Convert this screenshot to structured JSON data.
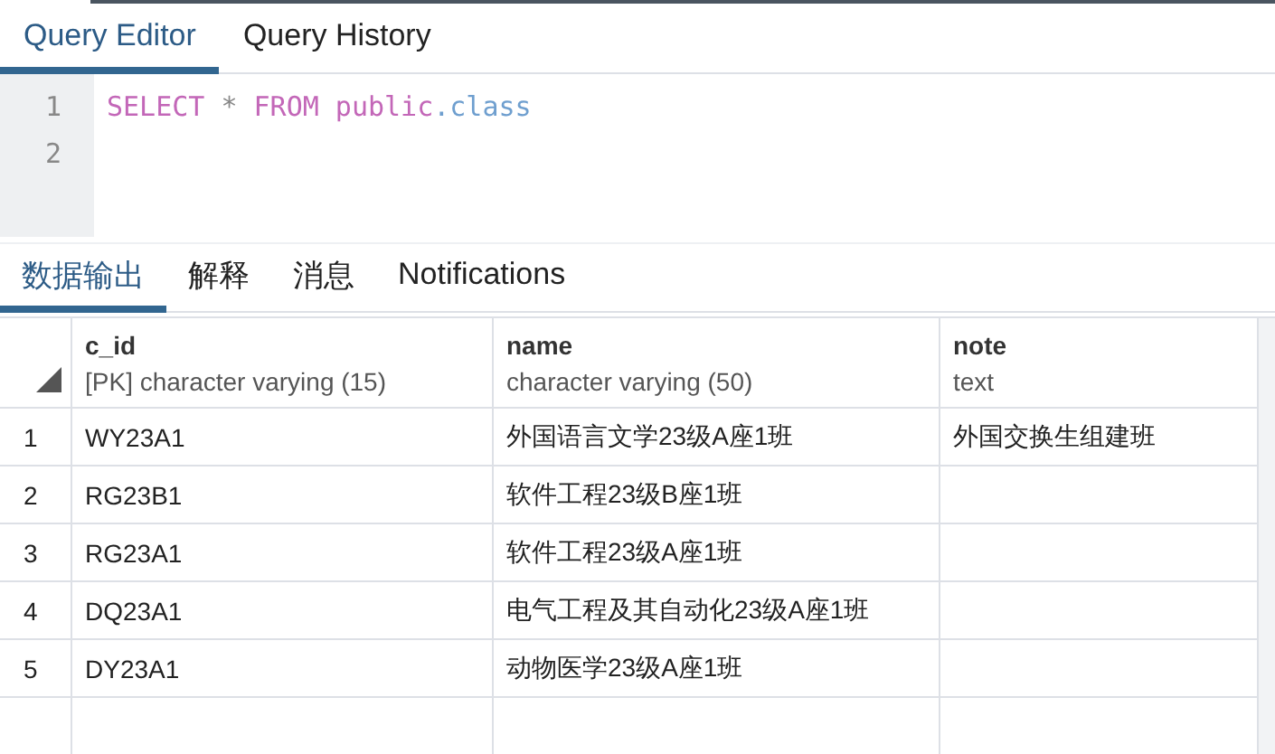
{
  "editor_tabs": [
    {
      "label": "Query Editor",
      "selected": true
    },
    {
      "label": "Query History",
      "selected": false
    }
  ],
  "editor": {
    "lines": [
      {
        "number": "1",
        "tokens": [
          {
            "kind": "keyword",
            "text": "SELECT"
          },
          {
            "kind": "operator",
            "text": " * "
          },
          {
            "kind": "keyword",
            "text": "FROM"
          },
          {
            "kind": "keyword",
            "text": " public"
          },
          {
            "kind": "identifier",
            "text": ".class"
          }
        ]
      },
      {
        "number": "2"
      }
    ]
  },
  "result_tabs": [
    {
      "label": "数据输出",
      "selected": true
    },
    {
      "label": "解释",
      "selected": false
    },
    {
      "label": "消息",
      "selected": false
    },
    {
      "label": "Notifications",
      "selected": false
    }
  ],
  "table": {
    "columns": [
      {
        "name": "c_id",
        "type": "[PK] character varying (15)"
      },
      {
        "name": "name",
        "type": "character varying (50)"
      },
      {
        "name": "note",
        "type": "text"
      }
    ],
    "rows": [
      {
        "number": "1",
        "cells": [
          "WY23A1",
          "外国语言文学23级A座1班",
          "外国交换生组建班"
        ]
      },
      {
        "number": "2",
        "cells": [
          "RG23B1",
          "软件工程23级B座1班",
          ""
        ]
      },
      {
        "number": "3",
        "cells": [
          "RG23A1",
          "软件工程23级A座1班",
          ""
        ]
      },
      {
        "number": "4",
        "cells": [
          "DQ23A1",
          "电气工程及其自动化23级A座1班",
          ""
        ]
      },
      {
        "number": "5",
        "cells": [
          "DY23A1",
          "动物医学23级A座1班",
          ""
        ]
      }
    ]
  }
}
